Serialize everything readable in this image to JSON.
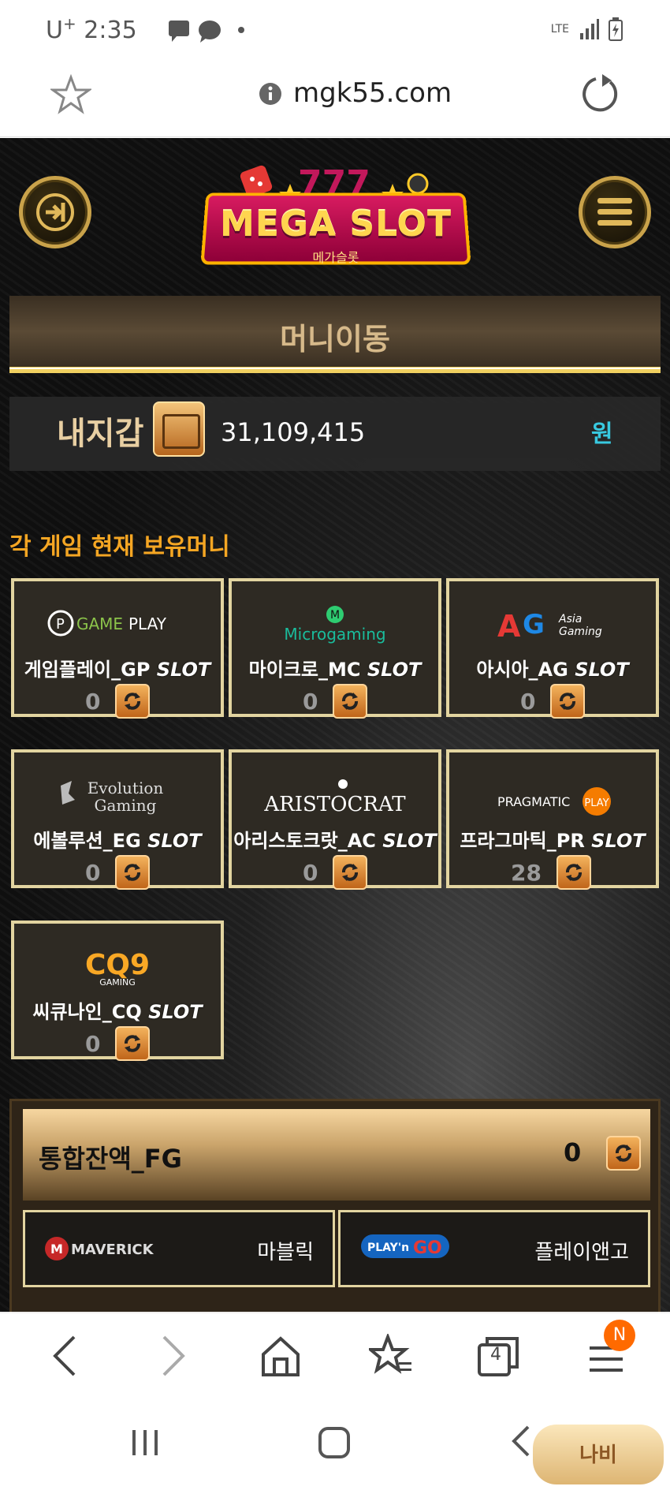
{
  "status": {
    "carrier": "U",
    "carrier_sup": "+",
    "time": "2:35",
    "network": "LTE"
  },
  "browser": {
    "url": "mgk55.com",
    "tab_count": "4",
    "menu_badge": "N"
  },
  "site": {
    "logo_text": "MEGA SLOT",
    "logo_sub": "메가슬롯",
    "page_title": "머니이동",
    "wallet": {
      "label": "내지갑",
      "amount": "31,109,415",
      "unit": "원"
    },
    "section_title": "각 게임 현재 보유머니",
    "games": [
      {
        "brand": "GAMEPLAY",
        "name": "게임플레이_GP",
        "tag": "SLOT",
        "value": "0"
      },
      {
        "brand": "Microgaming",
        "name": "마이크로_MC",
        "tag": "SLOT",
        "value": "0"
      },
      {
        "brand": "AG Asia Gaming",
        "name": "아시아_AG",
        "tag": "SLOT",
        "value": "0"
      },
      {
        "brand": "Evolution Gaming",
        "name": "에볼루션_EG",
        "tag": "SLOT",
        "value": "0"
      },
      {
        "brand": "ARISTOCRAT",
        "name": "아리스토크랏_AC",
        "tag": "SLOT",
        "value": "0"
      },
      {
        "brand": "PRAGMATIC PLAY",
        "name": "프라그마틱_PR",
        "tag": "SLOT",
        "value": "28"
      },
      {
        "brand": "CQ9 GAMING",
        "name": "씨큐나인_CQ",
        "tag": "SLOT",
        "value": "0"
      }
    ],
    "fg": {
      "label": "통합잔액_FG",
      "value": "0"
    },
    "providers": [
      {
        "logo": "MAVERICK",
        "name": "마블릭"
      },
      {
        "logo": "PLAY'n GO",
        "name": "플레이앤고"
      }
    ]
  },
  "floating_logo": "나비"
}
